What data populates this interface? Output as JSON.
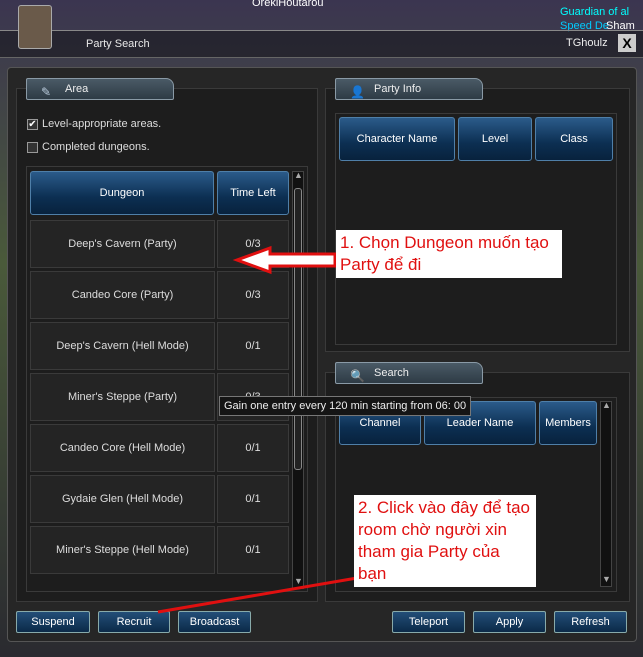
{
  "window": {
    "title": "Party Search",
    "close": "X"
  },
  "background_names": [
    "OrekiHoutarou",
    "TGhoulz",
    "Guardian of al",
    "Speed De",
    "Sham"
  ],
  "area": {
    "tab": "Area",
    "checkboxes": [
      {
        "label": "Level-appropriate areas.",
        "checked": true
      },
      {
        "label": "Completed dungeons.",
        "checked": false
      }
    ],
    "columns": [
      "Dungeon",
      "Time Left"
    ],
    "rows": [
      {
        "dungeon": "Deep's Cavern (Party)",
        "time": "0/3"
      },
      {
        "dungeon": "Candeo Core (Party)",
        "time": "0/3"
      },
      {
        "dungeon": "Deep's Cavern (Hell Mode)",
        "time": "0/1"
      },
      {
        "dungeon": "Miner's Steppe (Party)",
        "time": "0/3"
      },
      {
        "dungeon": "Candeo Core (Hell Mode)",
        "time": "0/1"
      },
      {
        "dungeon": "Gydaie Glen (Hell Mode)",
        "time": "0/1"
      },
      {
        "dungeon": "Miner's Steppe (Hell Mode)",
        "time": "0/1"
      }
    ]
  },
  "party_info": {
    "tab": "Party Info",
    "columns": [
      "Character Name",
      "Level",
      "Class"
    ]
  },
  "search": {
    "tab": "Search",
    "columns": [
      "Channel",
      "Leader Name",
      "Members"
    ]
  },
  "tooltip": "Gain one entry every  120 min starting from 06: 00",
  "buttons": {
    "suspend": "Suspend",
    "recruit": "Recruit",
    "broadcast": "Broadcast",
    "teleport": "Teleport",
    "apply": "Apply",
    "refresh": "Refresh"
  },
  "annotations": {
    "note1": "1. Chọn Dungeon muốn tạo Party để đi",
    "note2": "2. Click vào đây để tạo room chờ người xin tham gia Party của bạn",
    "color": "#e01010"
  }
}
